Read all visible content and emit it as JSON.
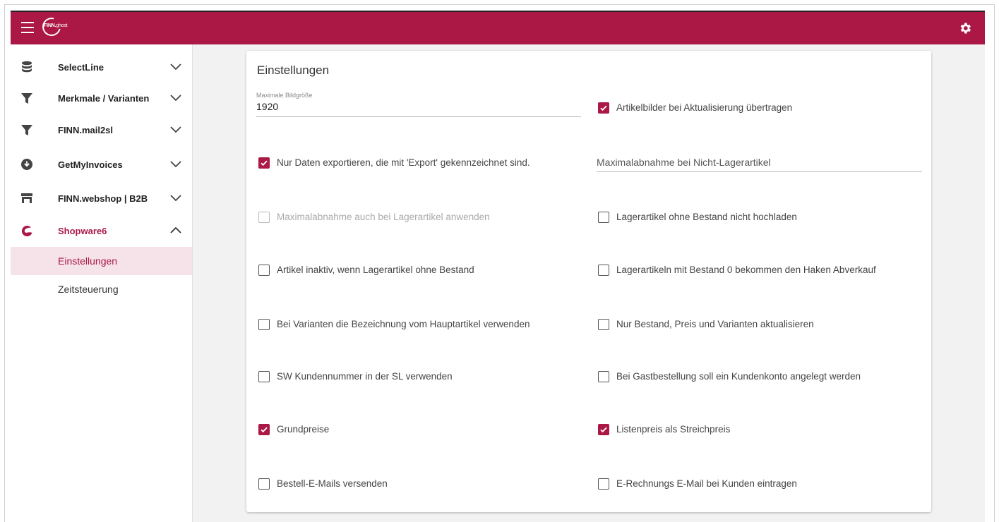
{
  "app": {
    "logo_brand": "FINN.",
    "logo_suffix": "ghost"
  },
  "sidebar": {
    "items": [
      {
        "label": "SelectLine",
        "icon": "database-icon"
      },
      {
        "label": "Merkmale / Varianten",
        "icon": "filter-icon"
      },
      {
        "label": "FINN.mail2sl",
        "icon": "filter-icon"
      },
      {
        "label": "GetMyInvoices",
        "icon": "download-circle-icon"
      },
      {
        "label": "FINN.webshop | B2B",
        "icon": "store-icon"
      },
      {
        "label": "Shopware6",
        "icon": "shopware-icon"
      }
    ],
    "subitems": [
      {
        "label": "Einstellungen",
        "selected": true
      },
      {
        "label": "Zeitsteuerung",
        "selected": false
      }
    ]
  },
  "card": {
    "title": "Einstellungen",
    "max_image_size": {
      "label": "Maximale Bildgröße",
      "value": "1920"
    },
    "max_purchase_field": {
      "placeholder": "Maximalabnahme bei Nicht-Lagerartikel"
    },
    "checkboxes": {
      "transfer_images": {
        "label": "Artikelbilder bei Aktualisierung übertragen",
        "checked": true
      },
      "export_only": {
        "label": "Nur Daten exportieren, die mit 'Export' gekennzeichnet sind.",
        "checked": true
      },
      "max_purchase_stock": {
        "label": "Maximalabnahme auch bei Lagerartikel anwenden",
        "checked": false,
        "disabled": true
      },
      "no_upload_without_stock": {
        "label": "Lagerartikel ohne Bestand nicht hochladen",
        "checked": false
      },
      "inactive_without_stock": {
        "label": "Artikel inaktiv, wenn Lagerartikel ohne Bestand",
        "checked": false
      },
      "abverkauf": {
        "label": "Lagerartikeln mit Bestand 0 bekommen den Haken Abverkauf",
        "checked": false
      },
      "variant_name": {
        "label": "Bei Varianten die Bezeichnung vom Hauptartikel verwenden",
        "checked": false
      },
      "update_only": {
        "label": "Nur Bestand, Preis und Varianten aktualisieren",
        "checked": false
      },
      "sw_customer_no": {
        "label": "SW Kundennummer in der SL verwenden",
        "checked": false
      },
      "guest_account": {
        "label": "Bei Gastbestellung soll ein Kundenkonto angelegt werden",
        "checked": false
      },
      "base_prices": {
        "label": "Grundpreise",
        "checked": true
      },
      "list_price": {
        "label": "Listenpreis als Streichpreis",
        "checked": true
      },
      "order_mails": {
        "label": "Bestell-E-Mails versenden",
        "checked": false
      },
      "invoice_mail": {
        "label": "E-Rechnungs E-Mail bei Kunden eintragen",
        "checked": false
      }
    }
  },
  "colors": {
    "brand": "#ab1846",
    "selected_bg": "#f5e3e9"
  }
}
